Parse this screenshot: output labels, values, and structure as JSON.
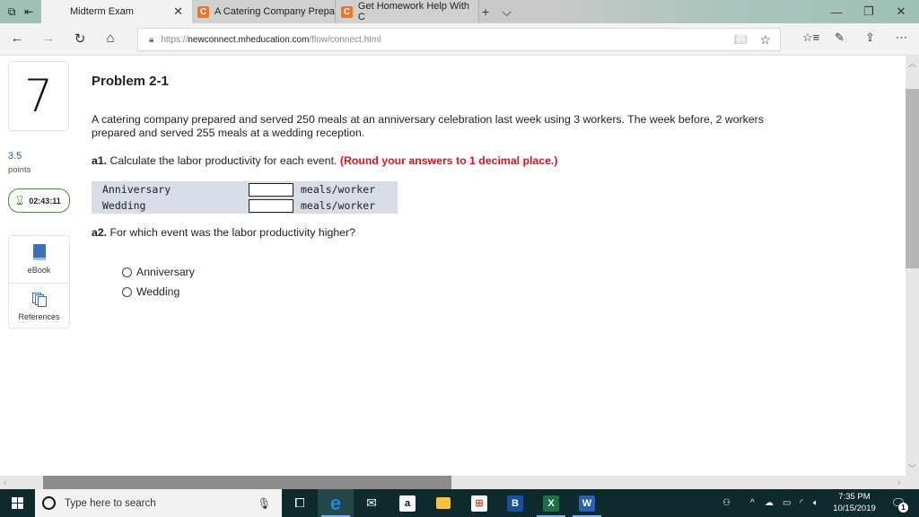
{
  "browser": {
    "tabs": [
      {
        "label": "Midterm Exam",
        "active": true
      },
      {
        "label": "A Catering Company Prepa",
        "favicon": "C",
        "active": false
      },
      {
        "label": "Get Homework Help With C",
        "favicon": "C",
        "active": false
      }
    ],
    "new_tab_icon": "+",
    "tab_list_icon": "⌵",
    "url_scheme": "https://",
    "url_domain": "newconnect.mheducation.com",
    "url_path": "/flow/connect.html"
  },
  "question": {
    "number": "7",
    "points_value": "3.5",
    "points_label": "points",
    "timer": "02:43:11",
    "resources": [
      {
        "label": "eBook",
        "icon": "book-icon"
      },
      {
        "label": "References",
        "icon": "references-icon"
      }
    ],
    "title": "Problem 2-1",
    "body": "A catering company prepared and served 250 meals at an anniversary celebration last week using 3 workers. The week before, 2 workers prepared and served 255 meals at a wedding reception.",
    "a1_label": "a1.",
    "a1_text": " Calculate the labor productivity for each event. ",
    "a1_note": "(Round your answers to 1 decimal place.)",
    "answer_rows": [
      {
        "label": "Anniversary",
        "value": "",
        "unit": "meals/worker"
      },
      {
        "label": "Wedding",
        "value": "",
        "unit": "meals/worker"
      }
    ],
    "a2_label": "a2.",
    "a2_text": " For which event was the labor productivity higher?",
    "options": [
      {
        "label": "Anniversary",
        "selected": false
      },
      {
        "label": "Wedding",
        "selected": false
      }
    ]
  },
  "taskbar": {
    "search_placeholder": "Type here to search",
    "time": "7:35 PM",
    "date": "10/15/2019",
    "notification_count": "1",
    "apps": [
      "task-view",
      "edge",
      "mail",
      "amazon",
      "file-explorer",
      "store",
      "booking",
      "excel",
      "word"
    ]
  },
  "colors": {
    "accent_red": "#e0101a",
    "points_blue": "#2d5c97",
    "timer_green": "#4d8a3a",
    "answer_bg": "#d7dce6"
  }
}
